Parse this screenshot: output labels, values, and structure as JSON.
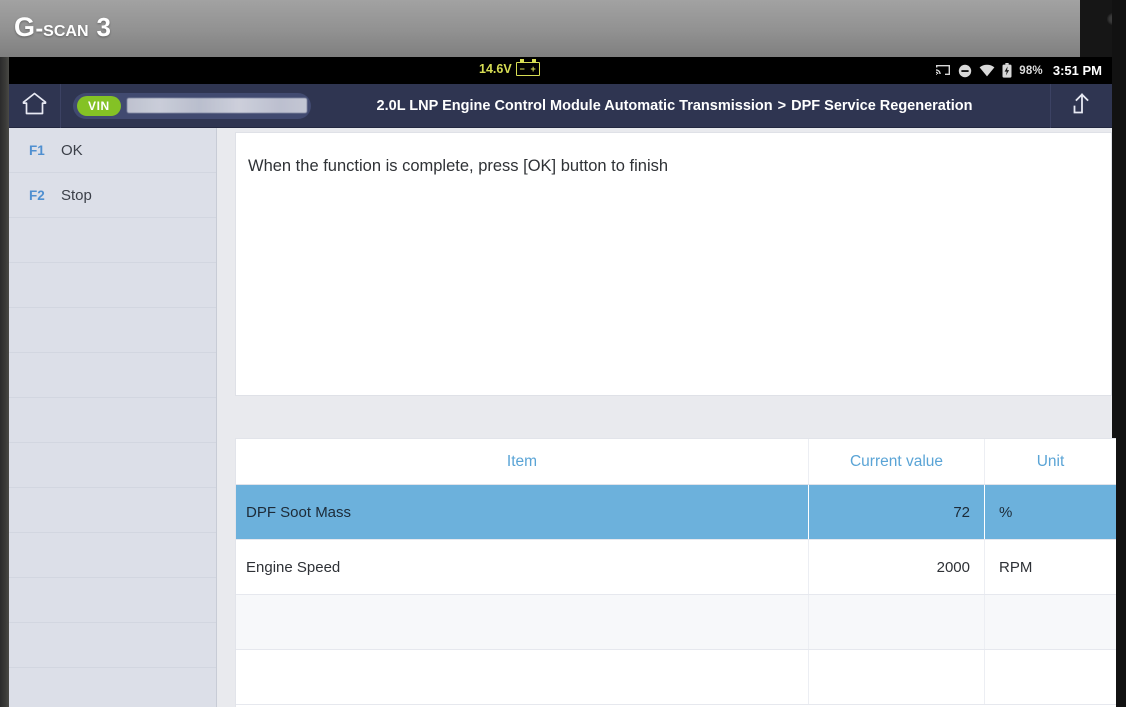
{
  "brand": {
    "logo_main": "G",
    "logo_mid": "-scan",
    "logo_num": "3"
  },
  "statusbar": {
    "voltage": "14.6V",
    "battery_icon": "car-battery-icon",
    "icons": [
      "cast-icon",
      "do-not-disturb-icon",
      "wifi-icon",
      "battery-charging-icon"
    ],
    "battery_percent": "98%",
    "clock": "3:51 PM"
  },
  "titlebar": {
    "home_icon": "home-icon",
    "vin_label": "VIN",
    "vin_value": "",
    "breadcrumb_root": "2.0L LNP Engine Control Module Automatic Transmission",
    "breadcrumb_sep": ">",
    "breadcrumb_leaf": "DPF Service Regeneration",
    "share_icon": "upload-share-icon"
  },
  "sidebar": {
    "items": [
      {
        "key": "F1",
        "label": "OK"
      },
      {
        "key": "F2",
        "label": "Stop"
      },
      {
        "key": "",
        "label": ""
      },
      {
        "key": "",
        "label": ""
      },
      {
        "key": "",
        "label": ""
      },
      {
        "key": "",
        "label": ""
      },
      {
        "key": "",
        "label": ""
      },
      {
        "key": "",
        "label": ""
      },
      {
        "key": "",
        "label": ""
      },
      {
        "key": "",
        "label": ""
      },
      {
        "key": "",
        "label": ""
      },
      {
        "key": "",
        "label": ""
      },
      {
        "key": "",
        "label": ""
      }
    ]
  },
  "message": {
    "text": "When the function is complete, press [OK] button to finish"
  },
  "table": {
    "headers": {
      "item": "Item",
      "value": "Current value",
      "unit": "Unit"
    },
    "rows": [
      {
        "item": "DPF Soot Mass",
        "value": "72",
        "unit": "%",
        "selected": true
      },
      {
        "item": "Engine Speed",
        "value": "2000",
        "unit": "RPM",
        "selected": false
      },
      {
        "item": "",
        "value": "",
        "unit": "",
        "selected": false
      },
      {
        "item": "",
        "value": "",
        "unit": "",
        "selected": false
      }
    ]
  },
  "colors": {
    "titlebar": "#2f3551",
    "accent_blue": "#5aa4d6",
    "selected_row": "#6cb1dc",
    "vin_green": "#84c225",
    "voltage_yellow": "#d7dd54",
    "sidebar_bg": "#dcdfe8"
  }
}
